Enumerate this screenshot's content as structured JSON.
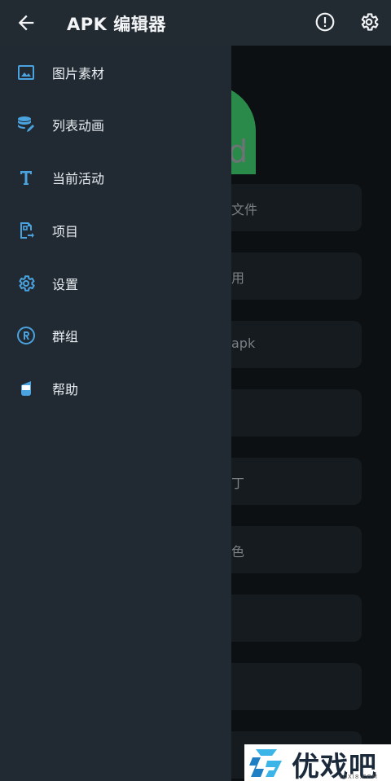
{
  "appbar": {
    "title": "APK 编辑器",
    "back_icon": "arrow-left-icon",
    "info_icon": "alert-circle-icon",
    "settings_icon": "gear-icon"
  },
  "drawer": {
    "items": [
      {
        "label": "图片素材",
        "icon": "image-icon"
      },
      {
        "label": "列表动画",
        "icon": "database-edit-icon"
      },
      {
        "label": "当前活动",
        "icon": "text-t-icon"
      },
      {
        "label": "项目",
        "icon": "file-export-icon"
      },
      {
        "label": "设置",
        "icon": "gear-icon"
      },
      {
        "label": "群组",
        "icon": "registered-icon"
      },
      {
        "label": "帮助",
        "icon": "cup-icon"
      }
    ]
  },
  "background": {
    "logo_text": "d",
    "cards": [
      "文件",
      "用",
      "apk",
      "",
      "丁",
      "色",
      "",
      "",
      ""
    ]
  },
  "watermark": {
    "text": "优戏吧",
    "sub": "YOXI8.COM"
  },
  "colors": {
    "accent": "#4aa3df",
    "drawer_bg": "#212a33",
    "appbar_bg": "#222a32"
  }
}
